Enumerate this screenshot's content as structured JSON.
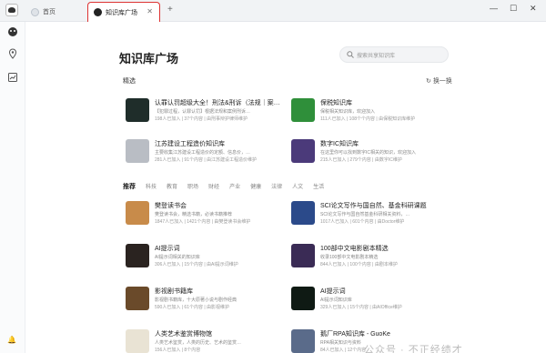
{
  "tabs": [
    {
      "label": "首页"
    },
    {
      "label": "知识库广场"
    }
  ],
  "page": {
    "title": "知识库广场",
    "search_placeholder": "搜索共享知识库",
    "section": "精选",
    "refresh_label": "换一换"
  },
  "featured": [
    {
      "title": "认罪认罚超级大全！刑法&刑诉（法规｜案…",
      "desc": "【犯罪过程，认罪认罚】根据法规和案例刑诉…",
      "meta": "198人已加入 | 37个内容 | 由刑事辩护律师维护",
      "color": "#1f2d2a"
    },
    {
      "title": "保税知识库",
      "desc": "保税相关知识库，欢迎加入",
      "meta": "111人已加入 | 108个个内容 | 由保税知识库维护",
      "color": "#2f8f3a"
    },
    {
      "title": "江苏建设工程造价知识库",
      "desc": "主要收集江苏建设工程造价的定额、信息价，…",
      "meta": "281人已加入 | 91个内容 | 由江苏建设工程造价维护",
      "color": "#b9bdc4"
    },
    {
      "title": "数字IC知识库",
      "desc": "在这里你可以找到数字IC相关的知识，欢迎加入",
      "meta": "215人已加入 | 279个内容 | 由数字IC维护",
      "color": "#4b3a7a"
    }
  ],
  "categories": [
    "推荐",
    "科技",
    "教育",
    "职场",
    "财经",
    "产业",
    "健康",
    "法律",
    "人文",
    "生活"
  ],
  "recommended": [
    {
      "title": "樊登读书会",
      "desc": "樊登读书会，精选书籍，必读书籍推荐",
      "meta": "1847人已加入 | 1421个内容 | 由樊登读书会维护",
      "color": "#c88b4a"
    },
    {
      "title": "SCI论文写作与国自然、基金科研课题",
      "desc": "SCI论文写作与国自然基金科研相关资料，…",
      "meta": "1017人已加入 | 601个内容 | 由Doctor维护",
      "color": "#2b4a8a"
    },
    {
      "title": "AI提示词",
      "desc": "AI提示词相关的知识库",
      "meta": "306人已加入 | 15个内容 | 由AI提示词维护",
      "color": "#2a2320"
    },
    {
      "title": "100部中文电影剧本精选",
      "desc": "收录100部中文电影剧本精选",
      "meta": "844人已加入 | 100个内容 | 由剧本维护",
      "color": "#3a2b55"
    },
    {
      "title": "影视剧书籍库",
      "desc": "影视剧书籍库，十大原著小说与剧作经典",
      "meta": "590人已加入 | 61个内容 | 由影视维护",
      "color": "#6a4a2a"
    },
    {
      "title": "AI提示词",
      "desc": "AI提示词知识库",
      "meta": "329人已加入 | 15个内容 | 由AIOffice维护",
      "color": "#0f1a14"
    },
    {
      "title": "人类艺术鉴赏博物馆",
      "desc": "人类艺术鉴赏，人类的历史、艺术的鉴赏…",
      "meta": "156人已加入 | 8个内容",
      "color": "#e9e3d4"
    },
    {
      "title": "鹅厂RPA知识库 - GuoKe",
      "desc": "RPA相关知识与资料",
      "meta": "84人已加入 | 12个内容",
      "color": "#5a6b8a"
    }
  ],
  "watermark": "公众号 · 不正经绩才"
}
